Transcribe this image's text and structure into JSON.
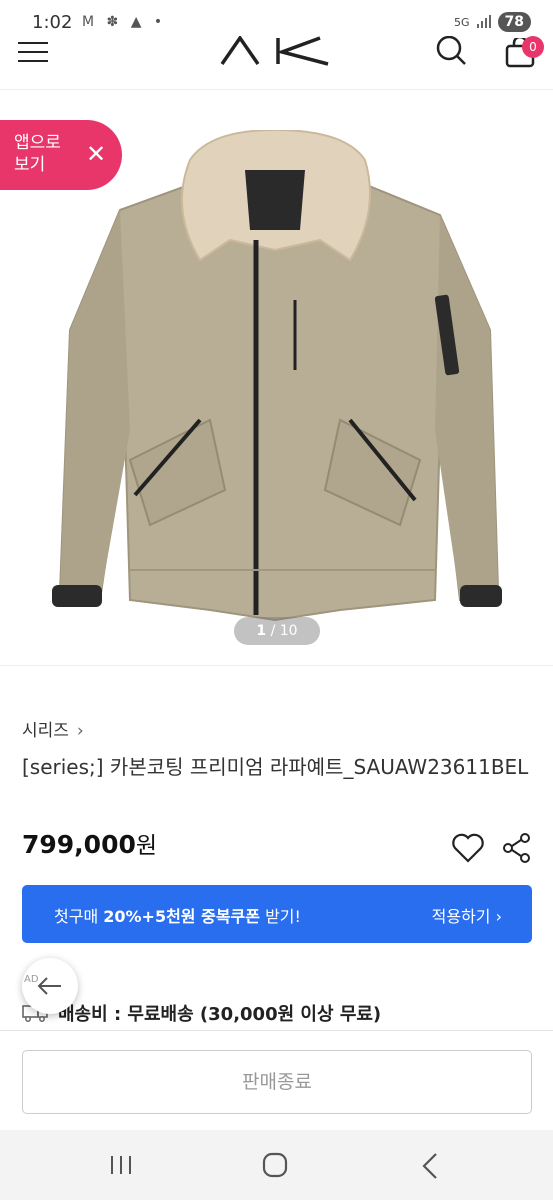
{
  "status_bar": {
    "time": "1:02",
    "icons_left": "M ✽ ▲ •",
    "network": "5G",
    "battery": "78"
  },
  "header": {
    "logo": "AK",
    "cart_count": "0",
    "icons": [
      "menu-icon",
      "logo",
      "search-icon",
      "shopping-bag-icon"
    ]
  },
  "gallery": {
    "app_banner_text": "앱으로\n보기",
    "app_banner_line1": "앱으로",
    "app_banner_line2": "보기",
    "close": "✕",
    "current": "1",
    "separator": " / ",
    "total": "10"
  },
  "product": {
    "breadcrumb": "시리즈",
    "breadcrumb_arrow": "›",
    "title": "[series;] 카본코팅 프리미엄 라파예트_SAUAW23611BEL",
    "price": "799,000",
    "price_unit": "원"
  },
  "coupon": {
    "prefix": "첫구매 ",
    "highlight": "20%+5천원 중복쿠폰",
    "suffix": " 받기!",
    "apply": "적용하기 ›"
  },
  "shipping": {
    "ad_label": "AD",
    "text": "배송비 : 무료배송 (30,000원 이상 무료)"
  },
  "cta": {
    "label": "판매종료"
  },
  "colors": {
    "brand_pink": "#e8366b",
    "coupon_blue": "#2a6ef0",
    "jacket_beige": "#b8ae96"
  }
}
